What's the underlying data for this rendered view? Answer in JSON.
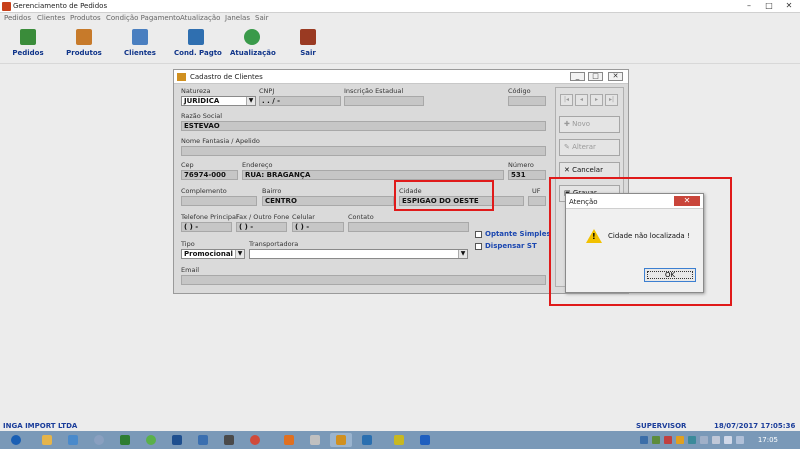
{
  "window": {
    "title": "Gerenciamento de Pedidos",
    "min": "–",
    "max": "□",
    "close": "✕"
  },
  "menu": [
    "Pedidos",
    "Clientes",
    "Produtos",
    "Condição Pagamento",
    "Atualização",
    "Janelas",
    "Sair"
  ],
  "toolbar": [
    {
      "label": "Pedidos",
      "icon": "pedidos-icon",
      "color": "#3a8c3a"
    },
    {
      "label": "Produtos",
      "icon": "produtos-icon",
      "color": "#c77a2a"
    },
    {
      "label": "Clientes",
      "icon": "clientes-icon",
      "color": "#4a7fc0"
    },
    {
      "label": "Cond. Pagto",
      "icon": "cond-pagto-icon",
      "color": "#2f6fb0"
    },
    {
      "label": "Atualização",
      "icon": "atualizacao-icon",
      "color": "#3a9a4a"
    },
    {
      "label": "Sair",
      "icon": "sair-icon",
      "color": "#9a3a22"
    }
  ],
  "cadastro": {
    "title": "Cadastro de Clientes",
    "labels": {
      "natureza": "Natureza",
      "cnpj": "CNPJ",
      "inscricao": "Inscrição Estadual",
      "codigo": "Código",
      "razao": "Razão Social",
      "fantasia": "Nome Fantasia / Apelido",
      "cep": "Cep",
      "endereco": "Endereço",
      "numero": "Número",
      "complemento": "Complemento",
      "bairro": "Bairro",
      "cidade": "Cidade",
      "uf": "UF",
      "telefone": "Telefone Principal",
      "fax": "Fax / Outro Fone",
      "celular": "Celular",
      "contato": "Contato",
      "tipo": "Tipo",
      "transportadora": "Transportadora",
      "email": "Email"
    },
    "values": {
      "natureza": "JURÍDICA",
      "cnpj": ".   .   /   -",
      "razao": "ESTEVÃO",
      "cep": "76974-000",
      "endereco": "RUA: BRAGANÇA",
      "numero": "531",
      "bairro": "CENTRO",
      "cidade": "ESPIGÃO DO OESTE",
      "telefone": "(  )    -",
      "fax": "(  )    -",
      "celular": "(  )    -",
      "tipo": "Promocional"
    },
    "checks": {
      "optante": "Optante Simples",
      "dispensar": "Dispensar ST"
    },
    "buttons": {
      "novo": "Novo",
      "alterar": "Alterar",
      "cancelar": "Cancelar",
      "gravar": "Gravar"
    },
    "nav": [
      "|◂",
      "◂",
      "▸",
      "▸|"
    ]
  },
  "dialog": {
    "title": "Atenção",
    "message": "Cidade não localizada !",
    "ok": "OK",
    "close": "✕"
  },
  "status": {
    "company": "INGA IMPORT LTDA",
    "user": "SUPERVISOR",
    "datetime": "18/07/2017 17:05:36"
  },
  "taskbar": {
    "clock": "17:05"
  }
}
